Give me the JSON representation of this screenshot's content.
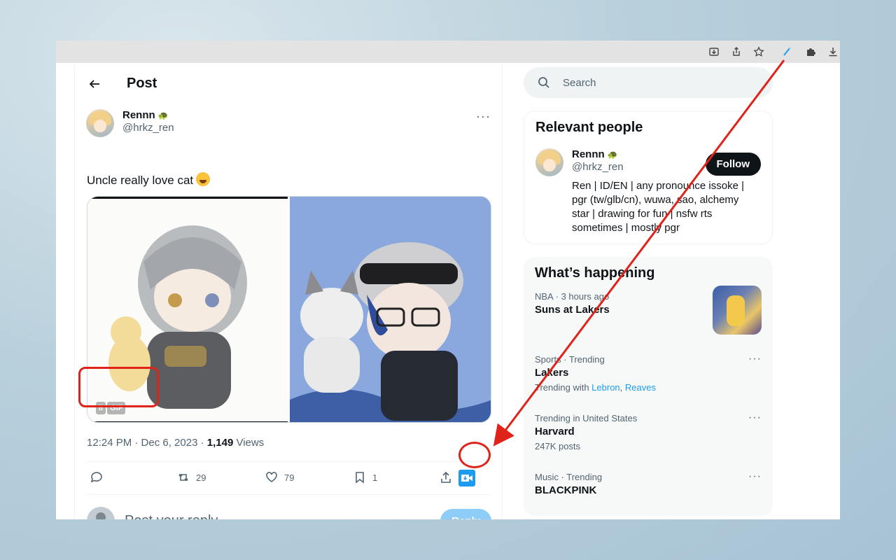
{
  "browser": {
    "toolbar_icons": [
      "save-page-icon",
      "share-icon",
      "bookmark-star-icon",
      "extension-icon",
      "puzzle-icon",
      "download-icon"
    ]
  },
  "post": {
    "header_title": "Post",
    "author_name": "Rennn",
    "author_handle": "@hrkz_ren",
    "author_badge": "turtle-emoji",
    "text": "Uncle really love cat",
    "gif_label": "GIF",
    "time": "12:24 PM · Dec 6, 2023 · ",
    "views_count": "1,149",
    "views_label": " Views",
    "retweets": "29",
    "likes": "79",
    "bookmarks": "1",
    "reply_placeholder": "Post your reply",
    "reply_button": "Reply"
  },
  "sidebar": {
    "search_placeholder": "Search",
    "relevant_title": "Relevant people",
    "person": {
      "name": "Rennn",
      "handle": "@hrkz_ren",
      "follow_label": "Follow",
      "bio": "Ren | ID/EN | any pronounce issoke | pgr (tw/glb/cn), wuwa, sao, alchemy star | drawing for fun | nsfw rts sometimes | mostly pgr"
    },
    "happening_title": "What’s happening",
    "trends": [
      {
        "meta": "NBA · 3 hours ago",
        "title": "Suns at Lakers",
        "sub": ""
      },
      {
        "meta": "Sports · Trending",
        "title": "Lakers",
        "sub_prefix": "Trending with ",
        "links": [
          "Lebron",
          "Reaves"
        ]
      },
      {
        "meta": "Trending in United States",
        "title": "Harvard",
        "sub": "247K posts"
      },
      {
        "meta": "Music · Trending",
        "title": "BLACKPINK",
        "sub": ""
      }
    ]
  },
  "colors": {
    "accent": "#1d9bf0",
    "annotation": "#e0231a",
    "text_primary": "#0f1419",
    "text_secondary": "#536471"
  }
}
